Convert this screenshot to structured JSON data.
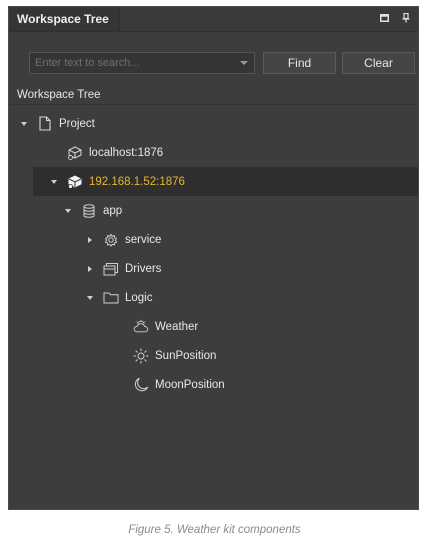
{
  "panel": {
    "title": "Workspace Tree",
    "section_label": "Workspace Tree"
  },
  "search": {
    "placeholder": "Enter text to search...",
    "find_label": "Find",
    "clear_label": "Clear"
  },
  "tree": {
    "items": [
      {
        "label": "Project",
        "icon": "document-icon",
        "expanded": true
      },
      {
        "label": "localhost:1876",
        "icon": "server-icon"
      },
      {
        "label": "192.168.1.52:1876",
        "icon": "server-connected-icon",
        "expanded": true,
        "selected": true,
        "highlight_color": "#e5b735"
      },
      {
        "label": "app",
        "icon": "database-icon",
        "expanded": true
      },
      {
        "label": "service",
        "icon": "gear-icon",
        "expanded": false
      },
      {
        "label": "Drivers",
        "icon": "drivers-icon",
        "expanded": false
      },
      {
        "label": "Logic",
        "icon": "folder-icon",
        "expanded": true
      },
      {
        "label": "Weather",
        "icon": "weather-icon"
      },
      {
        "label": "SunPosition",
        "icon": "sun-icon"
      },
      {
        "label": "MoonPosition",
        "icon": "moon-icon"
      }
    ]
  },
  "caption": "Figure 5. Weather kit components"
}
